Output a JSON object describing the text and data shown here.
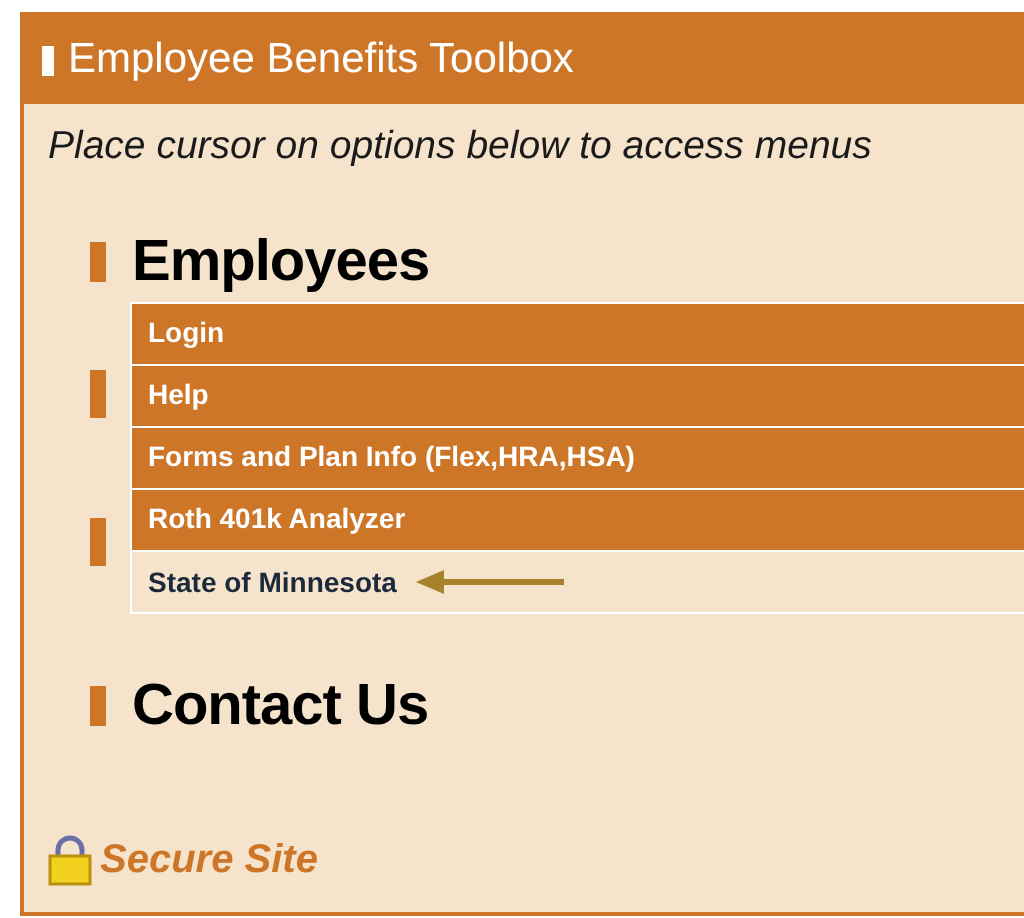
{
  "panel": {
    "title": "Employee Benefits Toolbox"
  },
  "instruction": "Place cursor on options below to access menus",
  "sections": [
    {
      "heading": "Employees",
      "menu": [
        {
          "label": "Login",
          "highlighted": false
        },
        {
          "label": "Help",
          "highlighted": false
        },
        {
          "label": "Forms and Plan Info (Flex,HRA,HSA)",
          "highlighted": false
        },
        {
          "label": "Roth 401k Analyzer",
          "highlighted": false
        },
        {
          "label": "State of Minnesota",
          "highlighted": true
        }
      ]
    },
    {
      "heading": "Contact Us"
    }
  ],
  "secure": "Secure Site"
}
